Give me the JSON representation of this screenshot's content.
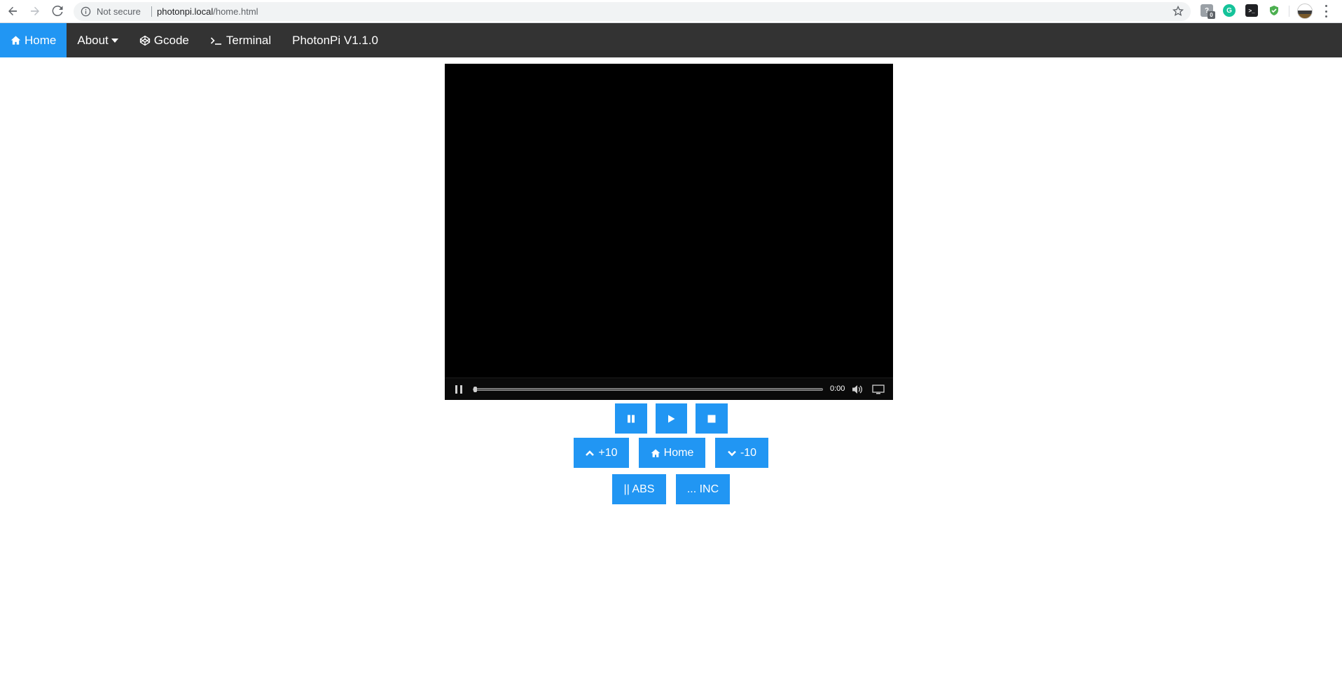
{
  "browser": {
    "security_label": "Not secure",
    "url_host": "photonpi.local",
    "url_path": "/home.html",
    "extension_badge_count": "0"
  },
  "nav": {
    "items": [
      {
        "label": "Home",
        "icon": "home-icon",
        "active": true
      },
      {
        "label": "About",
        "icon": "caret-down-icon",
        "active": false
      },
      {
        "label": "Gcode",
        "icon": "codepen-icon",
        "active": false
      },
      {
        "label": "Terminal",
        "icon": "terminal-icon",
        "active": false
      },
      {
        "label": "PhotonPi V1.1.0",
        "icon": "",
        "active": false
      }
    ]
  },
  "video": {
    "time": "0:00",
    "progress": 0.01
  },
  "controls": {
    "print_row": [
      {
        "name": "pause",
        "icon": "pause-icon"
      },
      {
        "name": "play",
        "icon": "play-icon"
      },
      {
        "name": "stop",
        "icon": "stop-icon"
      }
    ],
    "move_row": [
      {
        "name": "up10",
        "label": "+10",
        "icon": "chevron-up-icon"
      },
      {
        "name": "home",
        "label": "Home",
        "icon": "home-icon"
      },
      {
        "name": "down10",
        "label": "-10",
        "icon": "chevron-down-icon"
      }
    ],
    "mode_row": [
      {
        "name": "abs",
        "label": "|| ABS"
      },
      {
        "name": "inc",
        "label": "... INC"
      }
    ]
  },
  "colors": {
    "accent": "#2196F3",
    "navbar_bg": "#333333"
  }
}
